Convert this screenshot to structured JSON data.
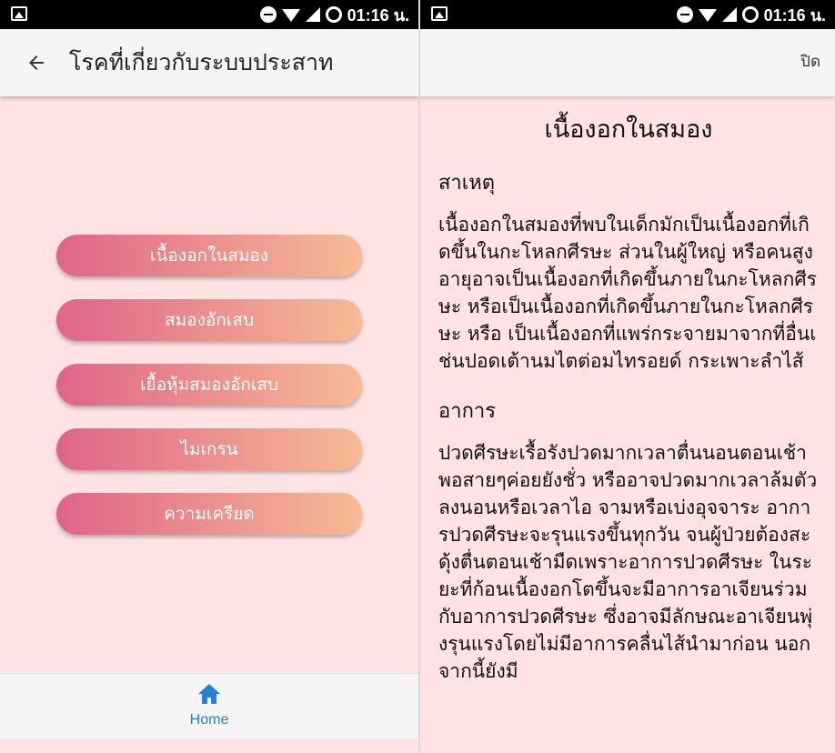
{
  "statusbar": {
    "time": "01:16 น."
  },
  "left": {
    "appbar": {
      "title": "โรคที่เกี่ยวกับระบบประสาท"
    },
    "menu": [
      {
        "label": "เนื้องอกในสมอง"
      },
      {
        "label": "สมองอักเสบ"
      },
      {
        "label": "เยื้อหุ้มสมองอักเสบ"
      },
      {
        "label": "ไมเกรน"
      },
      {
        "label": "ความเครียด"
      }
    ],
    "bottomnav": {
      "home_label": "Home",
      "accent": "#2a7fd6"
    }
  },
  "right": {
    "close_label": "ปิด",
    "title": "เนื้องอกในสมอง",
    "sections": [
      {
        "heading": "สาเหตุ",
        "body": "เนื้องอกในสมองที่พบในเด็กมักเป็นเนื้องอกที่เกิดขึ้นในกะโหลกศีรษะ ส่วนในผู้ใหญ่ หรือคนสูงอายุอาจเป็นเนื้องอกที่เกิดขึ้นภายในกะโหลกศีรษะ หรือเป็นเนื้องอกที่เกิดขึ้นภายในกะโหลกศีรษะ หรือ เป็นเนื้องอกที่แพร่กระจายมาจากที่อื่นเช่นปอดเต้านมไตต่อมไทรอยด์ กระเพาะลำไส้"
      },
      {
        "heading": "อาการ",
        "body": "ปวดศีรษะเรื้อรังปวดมากเวลาตื่นนอนตอนเช้าพอสายๆค่อยยังชั่ว หรืออาจปวดมากเวลาล้มตัวลงนอนหรือเวลาไอ จามหรือเบ่งอุจจาระ อาการปวดศีรษะจะรุนแรงขึ้นทุกวัน จนผู้ป่วยต้องสะดุ้งตื่นตอนเช้ามืดเพราะอาการปวดศีรษะ ในระยะที่ก้อนเนื้องอกโตขึ้นจะมีอาการอาเจียนร่วมกับอาการปวดศีรษะ ซึ่งอาจมีลักษณะอาเจียนพุ่งรุนแรงโดยไม่มีอาการคลื่นไส้นำมาก่อน นอกจากนี้ยังมี"
      }
    ]
  },
  "colors": {
    "background": "#ffe2e2",
    "button_start": "#df6488",
    "button_end": "#f6bb94"
  }
}
